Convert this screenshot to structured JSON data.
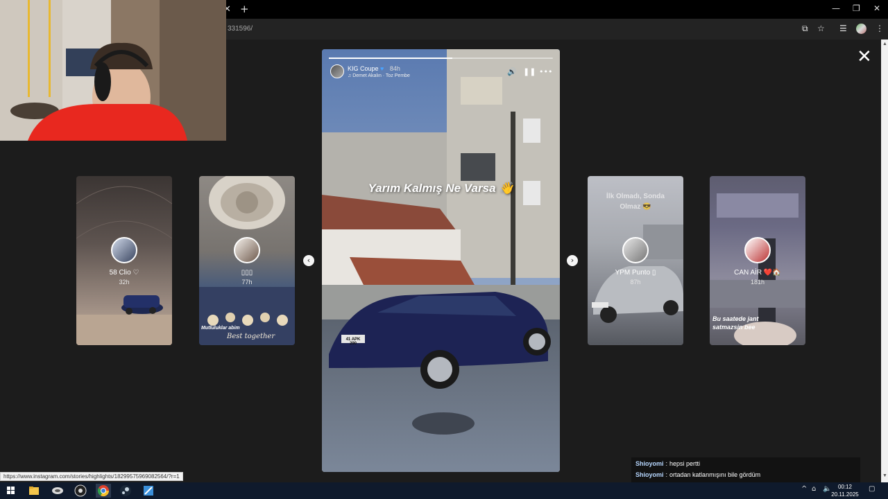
{
  "browser": {
    "url_suffix": "331596/",
    "tab_close_icon": "close-icon",
    "new_tab_icon": "plus-icon"
  },
  "viewer": {
    "close_icon": "close-icon",
    "prev_icon": "chevron-left-icon",
    "next_icon": "chevron-right-icon",
    "side_stories": [
      {
        "name": "58 Clio ♡",
        "time": "32h"
      },
      {
        "name": "▯▯▯",
        "time": "77h",
        "overlay_line1": "Mutluluklar abim",
        "overlay_line2": "Best together"
      },
      {
        "name": "YPM Punto ▯",
        "time": "87h",
        "overlay_text": "İlk Olmadı, Sonda Olmaz 😎"
      },
      {
        "name": "CAN AİR ❤️🏠",
        "time": "181h",
        "overlay_text": "Bu saatede jant satmazsin bee"
      }
    ],
    "main_story": {
      "username": "KIG Coupe",
      "verified_mark": "♥",
      "time": "84h",
      "music": "Demet Akalın · Toz Pembe",
      "caption": "Yarım Kalmış Ne Varsa 👋",
      "progress": 0.55,
      "plate": "41 APK 290"
    }
  },
  "chat": [
    {
      "user": "Shioyomi",
      "message": "hepsi pertti"
    },
    {
      "user": "Shioyomi",
      "message": "ortadan katlanmışını bile gördüm"
    }
  ],
  "statusbar": {
    "link": "https://www.instagram.com/stories/highlights/18299575969082564/?r=1"
  },
  "taskbar": {
    "time": "00:12",
    "date": "20.11.2025"
  }
}
